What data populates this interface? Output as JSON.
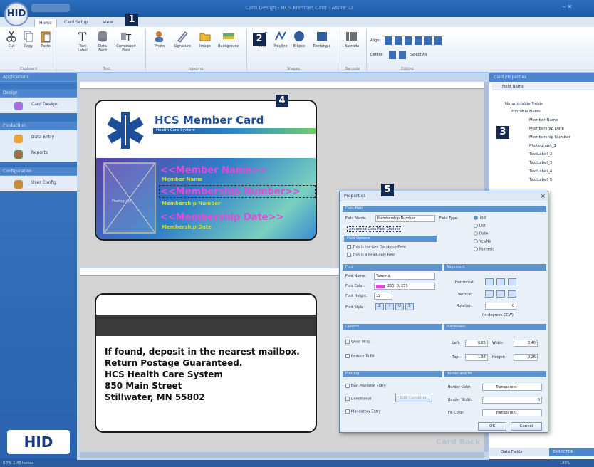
{
  "window": {
    "title": "Card Design - HCS Member Card - Asure ID",
    "logo": "HID"
  },
  "tabs": [
    {
      "label": "Home"
    },
    {
      "label": "Card Setup"
    },
    {
      "label": "View"
    }
  ],
  "ribbon": {
    "groups": [
      {
        "name": "Clipboard",
        "buttons": [
          "Cut",
          "Copy",
          "Paste"
        ]
      },
      {
        "name": "Text",
        "buttons": [
          "Text Label",
          "Data Field",
          "Compound Field"
        ]
      },
      {
        "name": "Imaging",
        "buttons": [
          "Photo",
          "Signature",
          "Image",
          "Background"
        ]
      },
      {
        "name": "Shapes",
        "buttons": [
          "Line",
          "Polyline",
          "Ellipse",
          "Rectangle"
        ]
      },
      {
        "name": "Barcode",
        "buttons": [
          "Barcode"
        ]
      },
      {
        "name": "Editing",
        "align_label": "Align:",
        "center_label": "Center:",
        "select_all_label": "Select All"
      }
    ]
  },
  "callouts": [
    "1",
    "2",
    "3",
    "4",
    "5"
  ],
  "left_panel": {
    "header": "Applications",
    "sections": [
      {
        "title": "Design",
        "items": [
          "Card Design"
        ]
      },
      {
        "title": "Production",
        "items": [
          "Data Entry",
          "Reports"
        ]
      },
      {
        "title": "Configuration",
        "items": [
          "User Config"
        ]
      }
    ],
    "footer_logo": "HID"
  },
  "card_front": {
    "title": "HCS Member Card",
    "subtitle": "Health Care System",
    "field_name": "<<Member Name>>",
    "field_name_sub": "Member Name",
    "field_number": "<<Membership Number>>",
    "field_number_sub": "Membership Number",
    "field_date": "<<Membership Date>>",
    "field_date_sub": "Membership Date",
    "photo_label": "Photograph"
  },
  "card_back": {
    "lines": [
      "If found, deposit in the nearest mailbox.",
      "Return Postage Guaranteed.",
      "HCS Health Care System",
      "850 Main Street",
      "Stillwater, MN 55802"
    ],
    "watermark": "Card Back"
  },
  "right_panel": {
    "header": "Card Properties",
    "column": "Field Name",
    "tree": [
      "Nonprintable Fields",
      "Printable Fields",
      "Member Name",
      "Membership Date",
      "Membership Number",
      "Photograph_1",
      "TextLabel_2",
      "TextLabel_3",
      "TextLabel_4",
      "TextLabel_5"
    ],
    "tabs": [
      "Data Fields",
      "DIRECTOR"
    ]
  },
  "dialog": {
    "title": "Properties",
    "close": "×",
    "data_field": {
      "header": "Data Field",
      "field_name_label": "Field Name:",
      "field_name_value": "Membership Number",
      "field_type_label": "Field Type:",
      "advanced_link": "Advanced Data Field Options",
      "types": [
        "Text",
        "List",
        "Date",
        "Yes/No",
        "Numeric"
      ],
      "options_header": "Field Options",
      "key_db": "This is the Key Database Field",
      "read_only": "This is a Read-only Field"
    },
    "font": {
      "header": "Font",
      "name_label": "Font Name:",
      "name_value": "Tahoma",
      "color_label": "Font Color:",
      "color_value": "255, 0, 255",
      "height_label": "Font Height:",
      "height_value": "12",
      "style_label": "Font Style:",
      "styles": [
        "B",
        "I",
        "U",
        "S"
      ]
    },
    "alignment": {
      "header": "Alignment",
      "horizontal": "Horizontal:",
      "vertical": "Vertical:",
      "rotation": "Rotation:",
      "rotation_value": "0",
      "rotation_note": "(In degrees CCW)"
    },
    "options": {
      "header": "Options",
      "word_wrap": "Word Wrap",
      "reduce": "Reduce To Fit"
    },
    "placement": {
      "header": "Placement",
      "left": "Left:",
      "left_value": "0.85",
      "top": "Top:",
      "top_value": "1.34",
      "width": "Width:",
      "width_value": "3.40",
      "height": "Height:",
      "height_value": "0.26"
    },
    "printing": {
      "header": "Printing",
      "non_printable": "Non-Printable Entry",
      "conditional": "Conditional",
      "edit_condition": "Edit Condition",
      "mandatory": "Mandatory Entry"
    },
    "border": {
      "header": "Border and Fill",
      "border_color": "Border Color:",
      "border_color_value": "Transparent",
      "border_width": "Border Width:",
      "border_width_value": "0",
      "fill_color": "Fill Color:",
      "fill_color_value": "Transparent"
    },
    "ok": "OK",
    "cancel": "Cancel"
  },
  "status": {
    "left": "0.74, 1.45 Inches",
    "zoom": "149%"
  },
  "colors": {
    "accent": "#1f5aa8",
    "magenta": "#e34bd6",
    "card_blue": "#1d4e9a"
  }
}
